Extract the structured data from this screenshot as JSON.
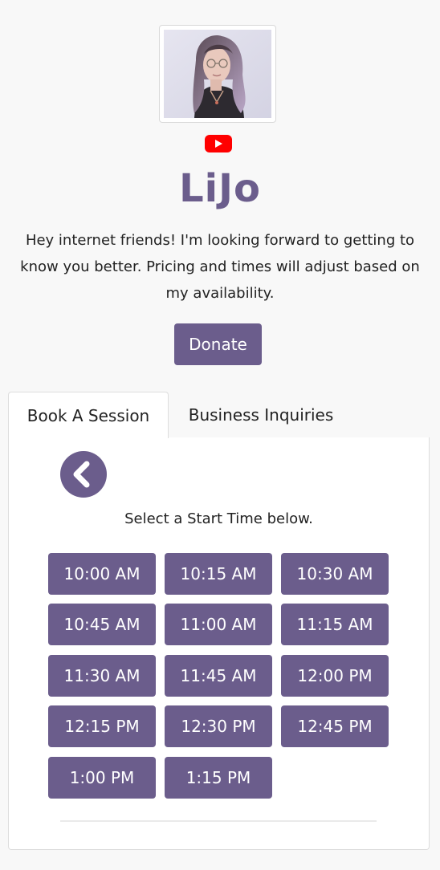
{
  "profile": {
    "brand_name": "LiJo",
    "bio": "Hey internet friends! I'm looking forward to getting to know you better. Pricing and times will adjust based on my availability.",
    "social_icon": "youtube-icon",
    "avatar": "profile-photo"
  },
  "donate_label": "Donate",
  "tabs": [
    {
      "label": "Book A Session",
      "active": true
    },
    {
      "label": "Business Inquiries",
      "active": false
    }
  ],
  "booking": {
    "back_icon": "chevron-left-icon",
    "instruction": "Select a Start Time below.",
    "times": [
      "10:00 AM",
      "10:15 AM",
      "10:30 AM",
      "10:45 AM",
      "11:00 AM",
      "11:15 AM",
      "11:30 AM",
      "11:45 AM",
      "12:00 PM",
      "12:15 PM",
      "12:30 PM",
      "12:45 PM",
      "1:00 PM",
      "1:15 PM"
    ]
  },
  "colors": {
    "accent": "#6b5d8c",
    "youtube_red": "#ff0000",
    "background": "#f8f8f8"
  }
}
